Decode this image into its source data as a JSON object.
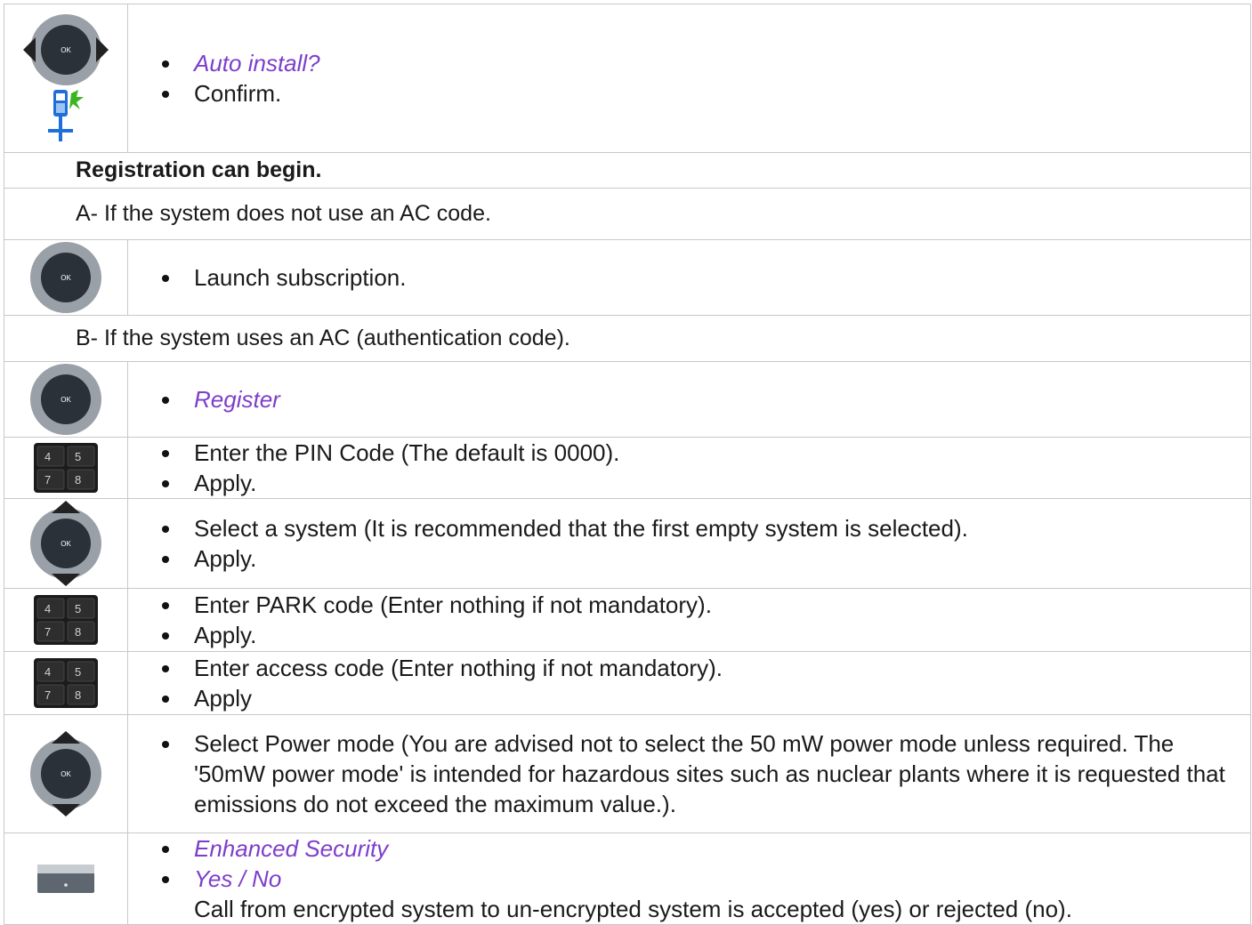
{
  "rows": [
    {
      "kind": "icon",
      "icon": "navigator-lr-icon",
      "extra_icon": "handset-install-icon",
      "items": [
        {
          "text": "Auto install?",
          "style": "italic"
        },
        {
          "text": "Confirm.",
          "style": "normal"
        }
      ]
    },
    {
      "kind": "full",
      "text": "Registration can begin.",
      "bold": true
    },
    {
      "kind": "full",
      "text": "A- If the system does not use an AC code.",
      "bold": false
    },
    {
      "kind": "icon",
      "icon": "ok-button-icon",
      "items": [
        {
          "text": "Launch subscription.",
          "style": "normal"
        }
      ]
    },
    {
      "kind": "full",
      "text": "B- If the system uses an AC (authentication code).",
      "bold": false
    },
    {
      "kind": "icon",
      "icon": "ok-button-icon",
      "items": [
        {
          "text": "Register",
          "style": "italic"
        }
      ]
    },
    {
      "kind": "icon",
      "icon": "keypad-icon",
      "items": [
        {
          "text": "Enter the PIN Code (The default is 0000).",
          "style": "normal"
        },
        {
          "text": "Apply.",
          "style": "normal"
        }
      ]
    },
    {
      "kind": "icon",
      "icon": "navigator-ud-icon",
      "items": [
        {
          "text": "Select a system (It is recommended that the first empty system is selected).",
          "style": "normal"
        },
        {
          "text": "Apply.",
          "style": "normal"
        }
      ]
    },
    {
      "kind": "icon",
      "icon": "keypad-icon",
      "items": [
        {
          "text": "Enter PARK code (Enter nothing if not mandatory).",
          "style": "normal"
        },
        {
          "text": "Apply.",
          "style": "normal"
        }
      ]
    },
    {
      "kind": "icon",
      "icon": "keypad-icon",
      "items": [
        {
          "text": "Enter access code (Enter nothing if not mandatory).",
          "style": "normal"
        },
        {
          "text": "Apply",
          "style": "normal"
        }
      ]
    },
    {
      "kind": "icon",
      "icon": "navigator-ud-icon",
      "items": [
        {
          "text": "Select Power mode (You are advised not to select the 50 mW power mode unless required. The '50mW power mode' is intended for hazardous sites such as nuclear plants where it is requested that emissions do not exceed the maximum value.).",
          "style": "normal"
        }
      ]
    },
    {
      "kind": "icon",
      "icon": "softkey-icon",
      "items": [
        {
          "text": "Enhanced Security",
          "style": "italic"
        },
        {
          "text": "Yes / No",
          "style": "italic"
        }
      ],
      "note": "Call from encrypted system to un-encrypted system is accepted (yes) or rejected (no)."
    }
  ],
  "keypad_keys": [
    "4",
    "5",
    "7",
    "8"
  ],
  "ok_label": "OK",
  "colors": {
    "accent_italic": "#7d3ec9",
    "border": "#c8c8c8",
    "install_blue": "#1e6fd9",
    "install_green": "#3cb521"
  }
}
